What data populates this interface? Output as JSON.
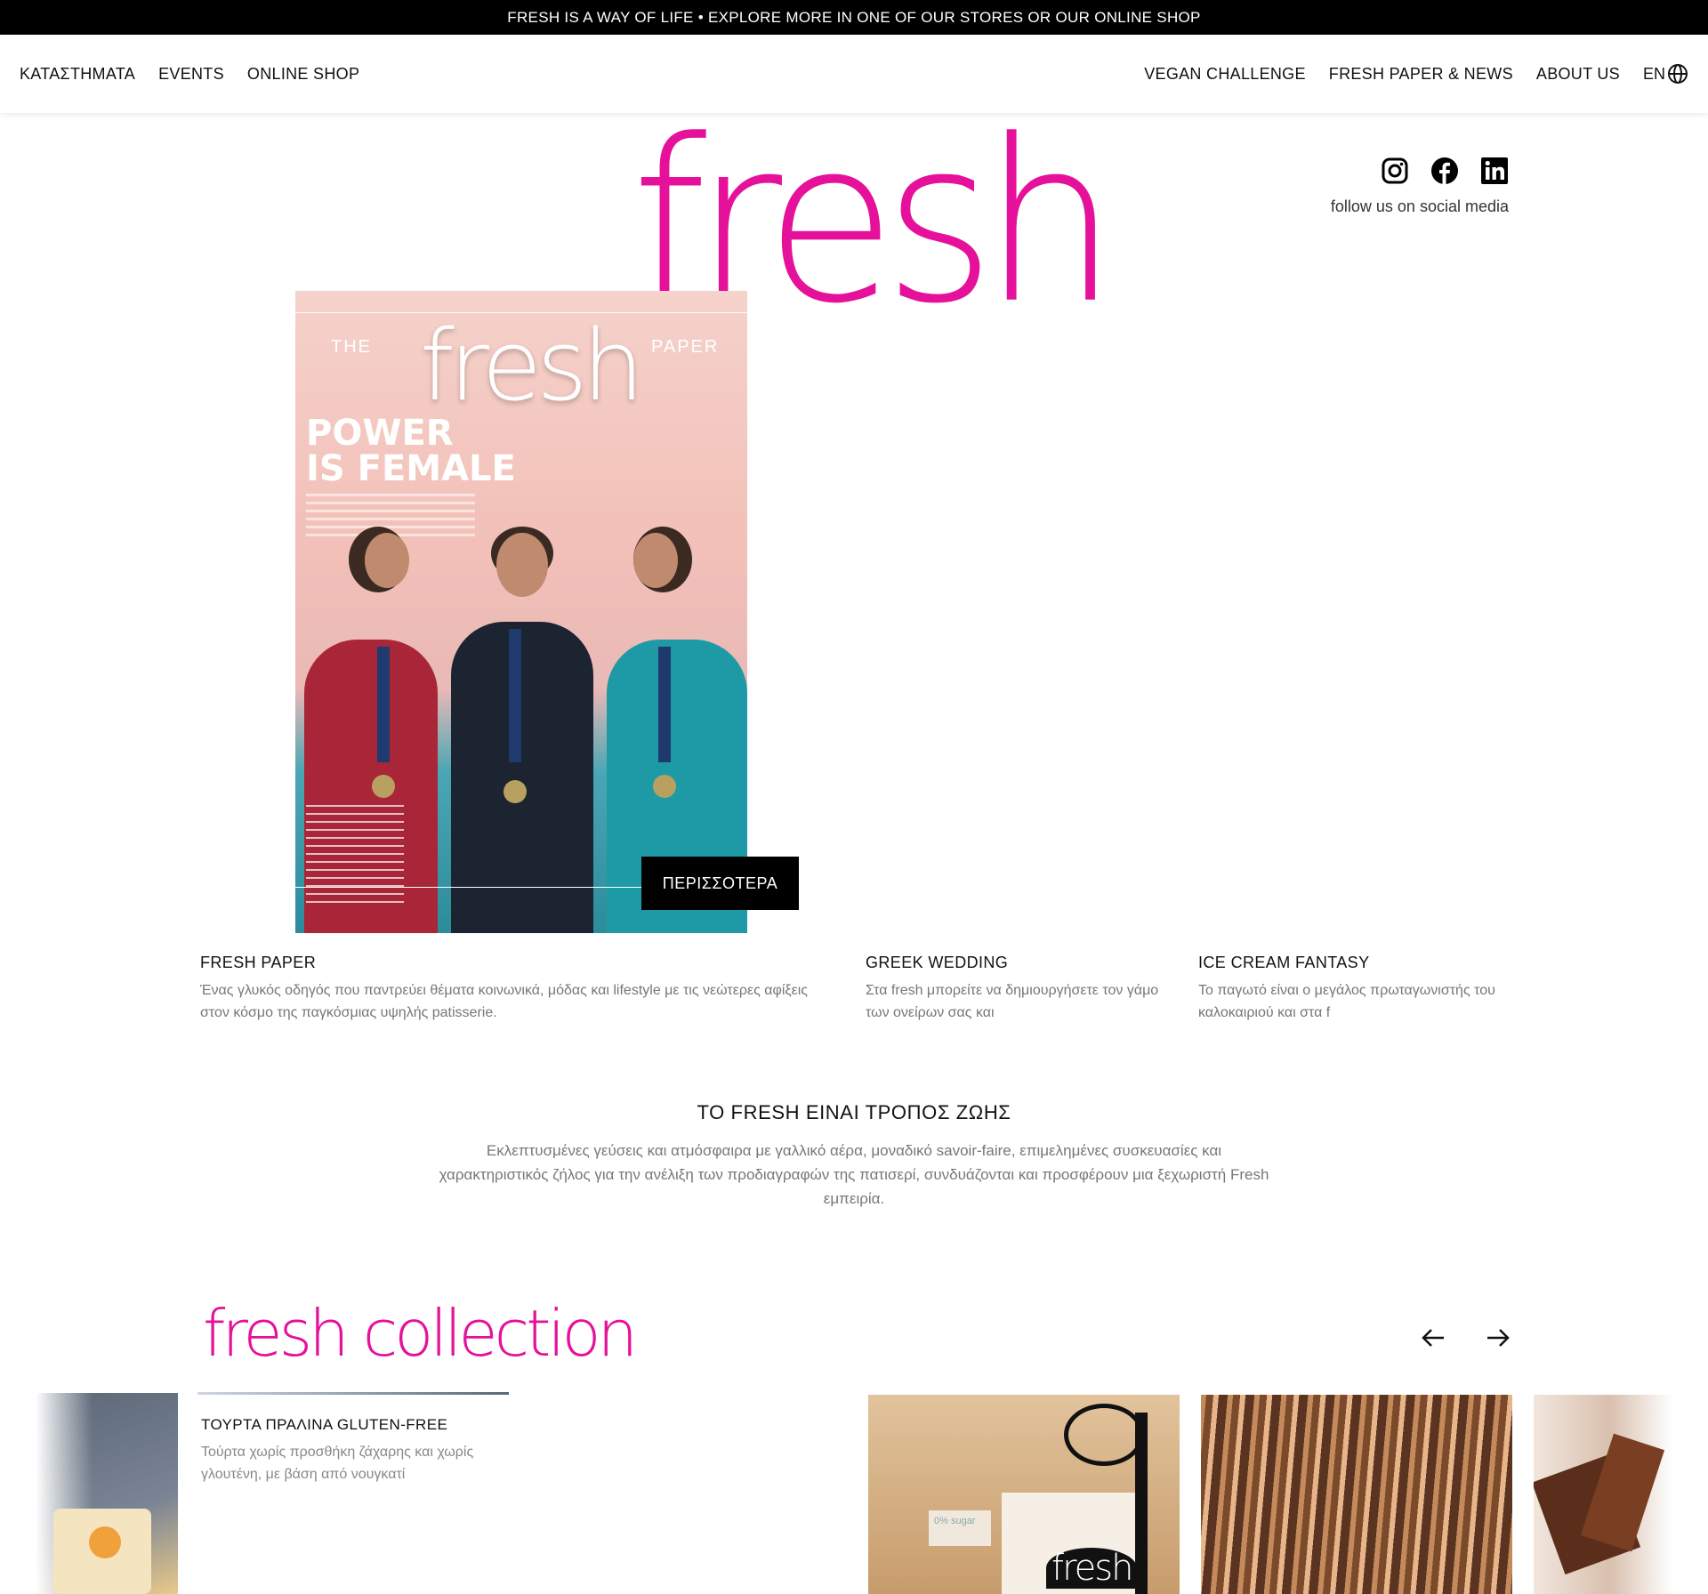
{
  "announcement": "FRESH IS A WAY OF LIFE • EXPLORE MORE IN ONE OF OUR STORES OR OUR ONLINE SHOP",
  "nav": {
    "left": [
      "ΚΑΤΑΣΤΗΜΑΤΑ",
      "EVENTS",
      "ONLINE SHOP"
    ],
    "right": [
      "VEGAN CHALLENGE",
      "FRESH PAPER & NEWS",
      "ABOUT US"
    ],
    "lang": "EN",
    "lang_icon": "globe-icon"
  },
  "logo": "fresh",
  "social": {
    "icons": [
      "instagram-icon",
      "facebook-icon",
      "linkedin-icon"
    ],
    "text": "follow us on social media"
  },
  "hero": {
    "magazine_title": "fresh",
    "magazine_side_left": "THE",
    "magazine_side_right": "PAPER",
    "magazine_headline": "POWER\nIS FEMALE",
    "more_button": "ΠΕΡΙΣΣΟΤΕΡΑ"
  },
  "features": [
    {
      "title": "FRESH PAPER",
      "text": "Ένας γλυκός οδηγός που παντρεύει θέματα κοινωνικά, μόδας και lifestyle με τις νεώτερες αφίξεις στον κόσμο της παγκόσμιας υψηλής patisserie."
    },
    {
      "title": "GREEK WEDDING",
      "text": "Στα fresh μπορείτε να δημιουργήσετε τον γάμο των ονείρων σας και"
    },
    {
      "title": "ICE CREAM FANTASY",
      "text": "Το παγωτό είναι ο μεγάλος πρωταγωνιστής του καλοκαιριού και στα f"
    }
  ],
  "intro": {
    "title": "ΤΟ FRESH ΕΙΝΑΙ ΤΡΟΠΟΣ ΖΩΗΣ",
    "text": "Εκλεπτυσμένες γεύσεις και ατμόσφαιρα με γαλλικό αέρα, μοναδικό savoir-faire, επιμελημένες συσκευασίες και χαρακτηριστικός ζήλος για την ανέλιξη των προδιαγραφών της πατισερί, συνδυάζονται και προσφέρουν μια ξεχωριστή Fresh εμπειρία."
  },
  "collection": {
    "title": "fresh collection",
    "prev_icon": "arrow-left-icon",
    "next_icon": "arrow-right-icon",
    "card": {
      "title": "ΤΟΥΡΤΑ ΠΡΑΛΙΝΑ GLUTEN-FREE",
      "text": "Τούρτα χωρίς προσθήκη ζάχαρης και χωρίς γλουτένη, με βάση από νουγκατί"
    },
    "box_label": "0% sugar",
    "box_brand": "fresh"
  },
  "colors": {
    "brand_pink": "#e6119a",
    "topbar_bg": "#000000",
    "button_bg": "#000000",
    "muted_text": "#777777"
  }
}
